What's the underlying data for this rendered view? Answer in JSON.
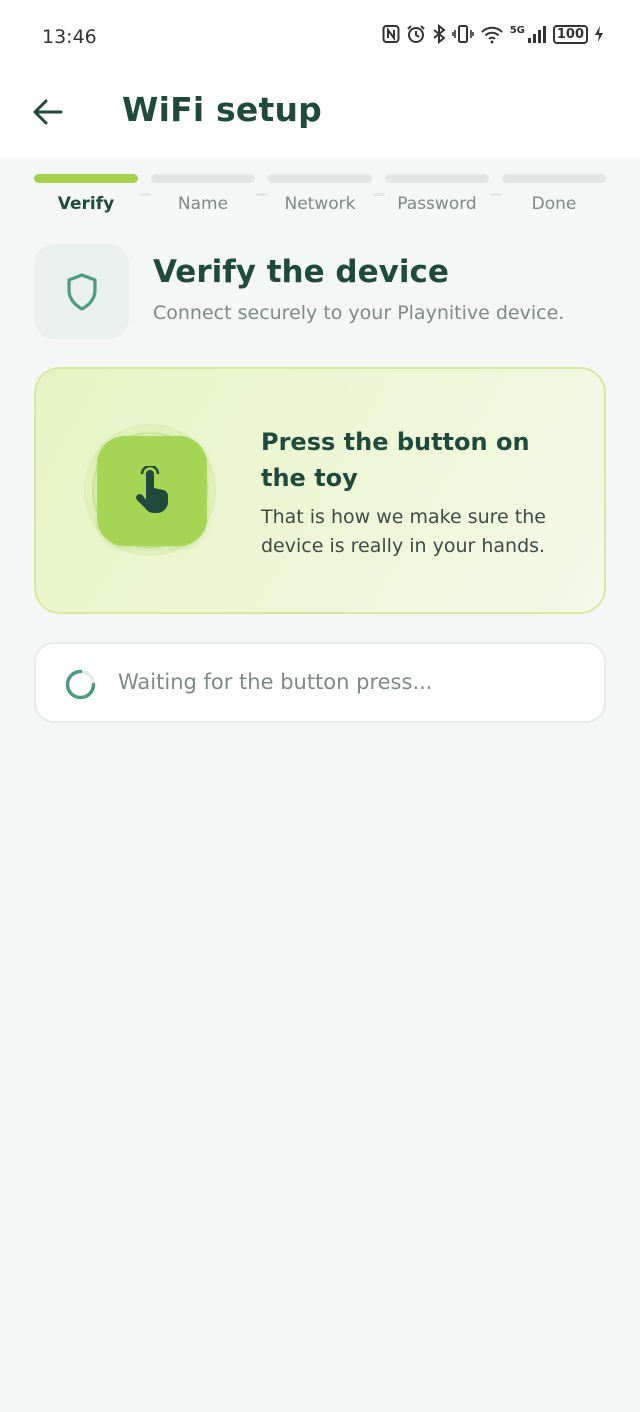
{
  "status_bar": {
    "time": "13:46",
    "battery": "100",
    "network": "5G",
    "icons": [
      "nfc-icon",
      "alarm-icon",
      "bluetooth-icon",
      "vibrate-icon",
      "wifi-icon",
      "signal-icon",
      "battery-icon",
      "charging-icon"
    ]
  },
  "app_bar": {
    "back_icon": "arrow-left-icon",
    "title": "WiFi setup"
  },
  "steps": [
    {
      "label": "Verify",
      "active": true
    },
    {
      "label": "Name",
      "active": false
    },
    {
      "label": "Network",
      "active": false
    },
    {
      "label": "Password",
      "active": false
    },
    {
      "label": "Done",
      "active": false
    }
  ],
  "header": {
    "icon": "shield-icon",
    "title": "Verify the device",
    "subtitle": "Connect securely to your Playnitive device."
  },
  "press_card": {
    "icon": "hand-pointer-icon",
    "title": "Press the button on the toy",
    "text": "That is how we make sure the device is really in your hands."
  },
  "status_card": {
    "icon": "spinner-icon",
    "text": "Waiting for the button press..."
  },
  "colors": {
    "primary": "#1f4a3c",
    "accent": "#a6d14f",
    "muted": "#7d8a86",
    "background": "#f4f7f6"
  }
}
